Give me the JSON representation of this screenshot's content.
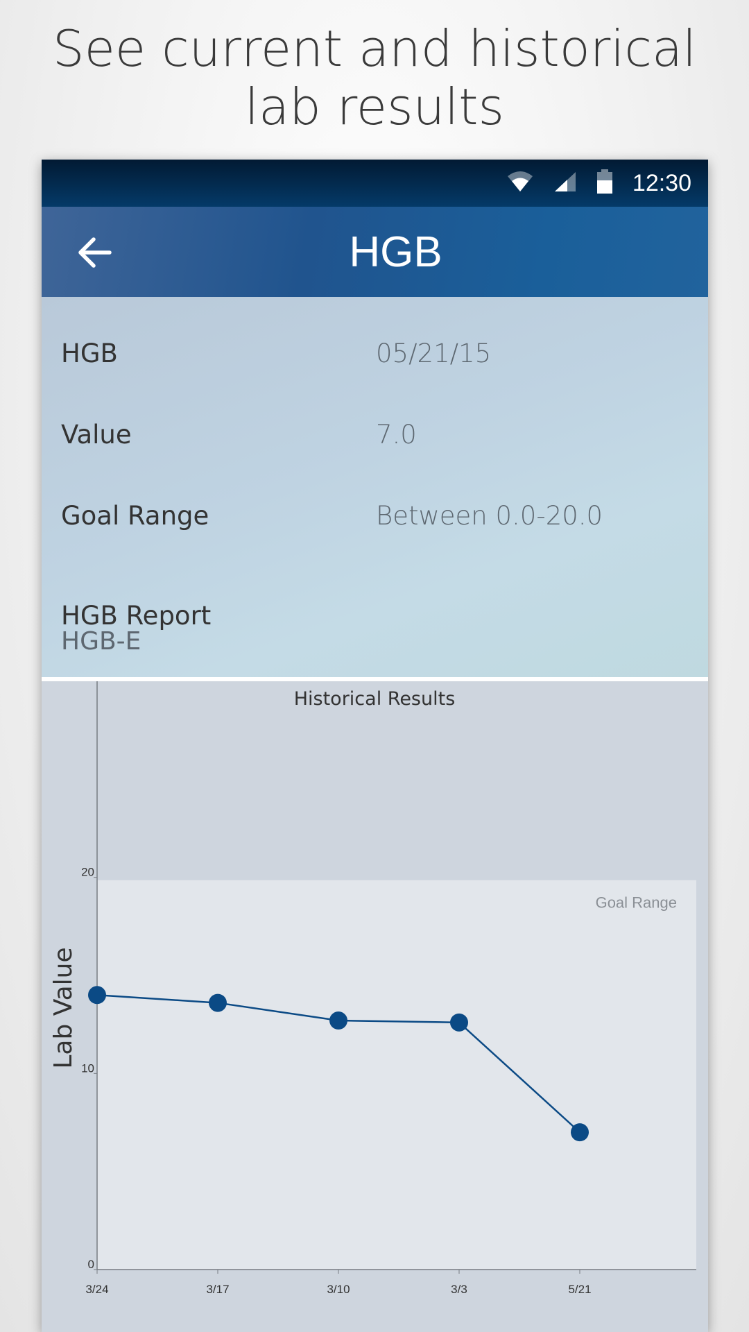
{
  "headline": {
    "line1": "See current and historical",
    "line2": "lab results"
  },
  "status_bar": {
    "time": "12:30",
    "icons": [
      "wifi-icon",
      "cell-signal-icon",
      "battery-icon"
    ]
  },
  "app_bar": {
    "title": "HGB",
    "back_icon": "arrow-left-icon"
  },
  "details": {
    "rows": [
      {
        "label": "HGB",
        "value": "05/21/15"
      },
      {
        "label": "Value",
        "value": "7.0"
      },
      {
        "label": "Goal Range",
        "value": "Between 0.0-20.0"
      }
    ],
    "report_label": "HGB Report",
    "report_value": "HGB-E"
  },
  "colors": {
    "status_bar": "#021a33",
    "app_bar": "#20548e",
    "series": "#0b4a85",
    "goal_band": "#e2e6eb",
    "chart_bg": "#ced5de"
  },
  "chart_data": {
    "type": "line",
    "title": "Historical Results",
    "ylabel": "Lab Value",
    "xlabel": "",
    "categories": [
      "3/24",
      "3/17",
      "3/10",
      "3/3",
      "5/21"
    ],
    "series": [
      {
        "values": [
          14.0,
          13.6,
          12.7,
          12.6,
          7.0
        ]
      }
    ],
    "ylim": [
      0,
      30
    ],
    "yticks": [
      0,
      10,
      20
    ],
    "goal_range": {
      "label": "Goal Range",
      "min": 0,
      "max": 20
    }
  }
}
